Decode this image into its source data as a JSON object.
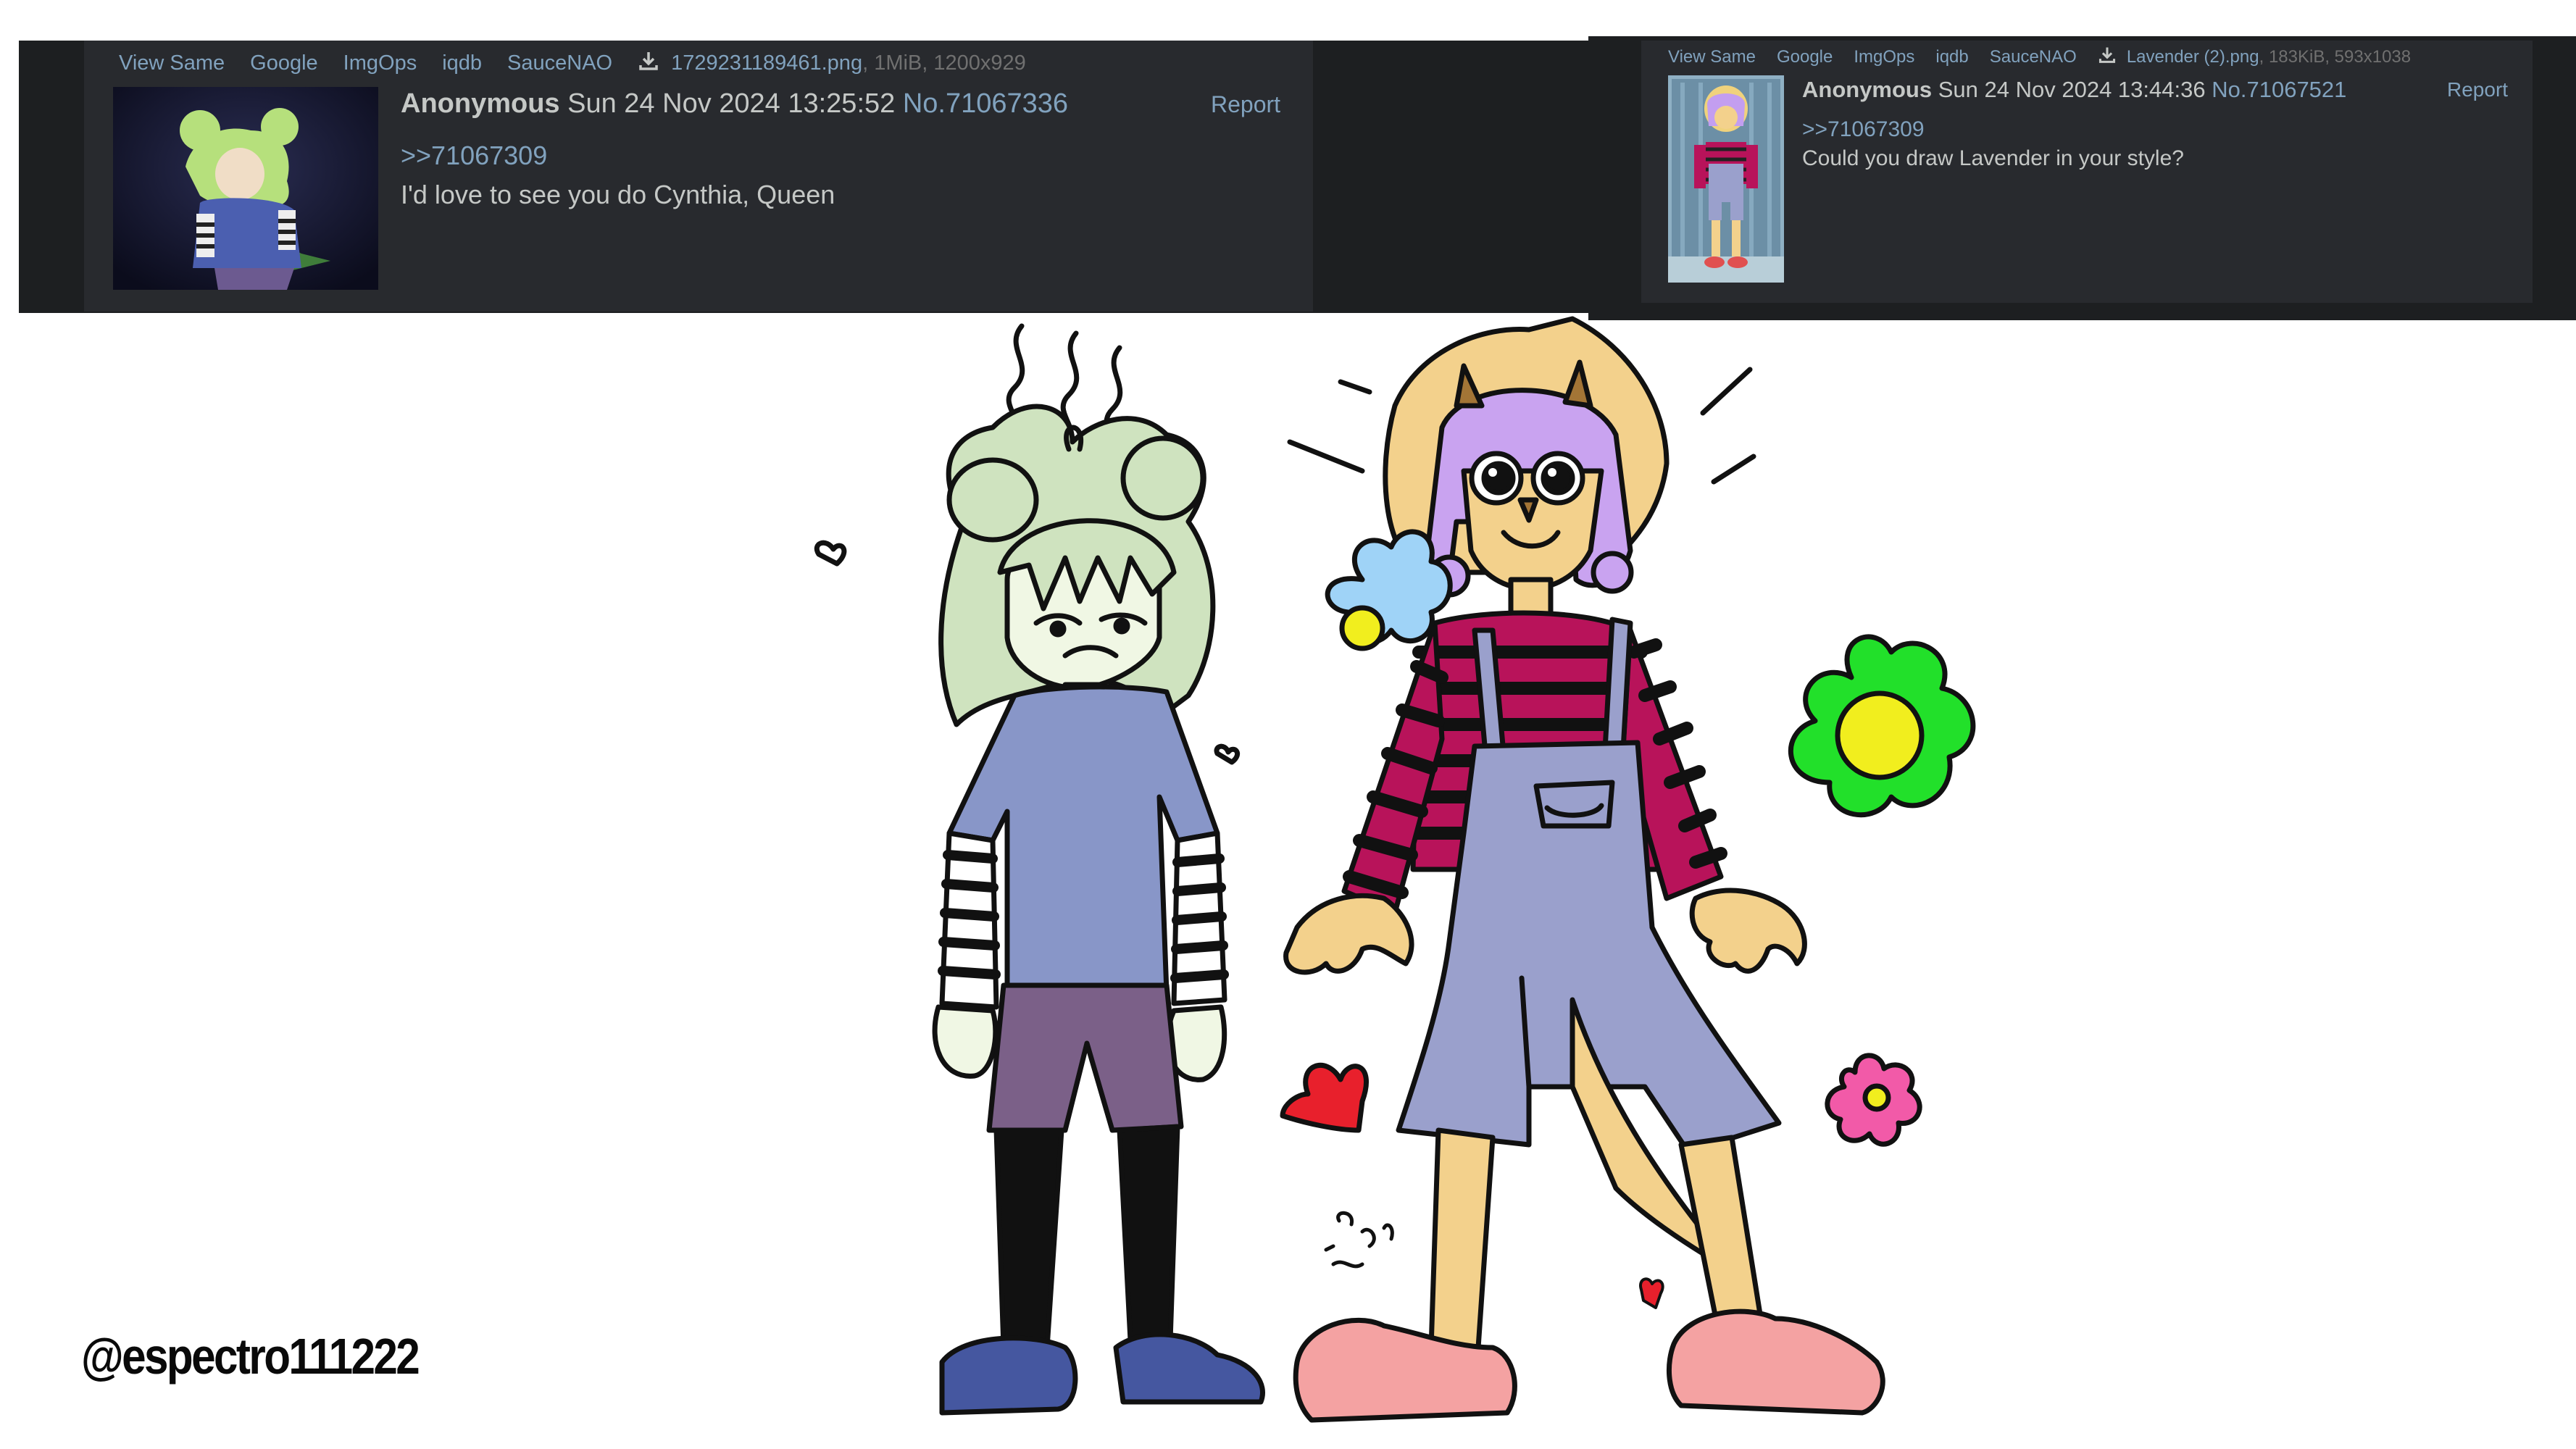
{
  "post_left": {
    "tools": [
      "View Same",
      "Google",
      "ImgOps",
      "iqdb",
      "SauceNAO"
    ],
    "file_name": "1729231189461.png",
    "file_meta": ", 1MiB, 1200x929",
    "name": "Anonymous",
    "date": "Sun 24 Nov 2024 13:25:52",
    "number": "No.71067336",
    "report": "Report",
    "quote_link": ">>71067309",
    "message": "I'd love to see you do Cynthia, Queen",
    "thumbnail_icon": "character-thumbnail-cynthia"
  },
  "post_right": {
    "tools": [
      "View Same",
      "Google",
      "ImgOps",
      "iqdb",
      "SauceNAO"
    ],
    "file_name": "Lavender (2).png",
    "file_meta": ", 183KiB, 593x1038",
    "name": "Anonymous",
    "date": "Sun 24 Nov 2024 13:44:36",
    "number": "No.71067521",
    "report": "Report",
    "quote_link": ">>71067309",
    "message": "Could you draw Lavender in your style?",
    "thumbnail_icon": "character-thumbnail-lavender"
  },
  "artwork": {
    "signature": "@espectro111222",
    "colors": {
      "cynthia_hair": "#cfe3bf",
      "cynthia_shirt": "#8896c8",
      "cynthia_shorts": "#7b6088",
      "cynthia_shoes": "#4557a0",
      "lavender_hair": "#c9a3f0",
      "lavender_skin": "#f3d18c",
      "lavender_stripe": "#b8135a",
      "lavender_overalls": "#9aa0cc",
      "lavender_shoes": "#f4a2a2",
      "flower_blue": "#9fd3f7",
      "flower_green": "#22e02a",
      "flower_pink": "#f25aa8",
      "flower_center": "#f1ee1e",
      "heart_red": "#e8202c"
    }
  }
}
